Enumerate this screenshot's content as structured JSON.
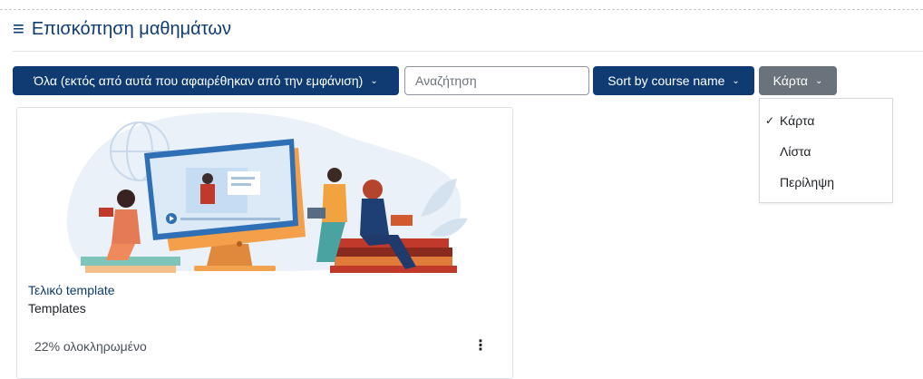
{
  "block": {
    "title": "Επισκόπηση μαθημάτων",
    "menu_icon": "hamburger-icon"
  },
  "controls": {
    "grouping_label": "Όλα (εκτός από αυτά που αφαιρέθηκαν από την εμφάνιση)",
    "search_placeholder": "Αναζήτηση",
    "search_value": "",
    "sort_label": "Sort by course name",
    "view_label": "Κάρτα"
  },
  "view_menu": {
    "items": [
      {
        "label": "Κάρτα",
        "selected": true
      },
      {
        "label": "Λίστα",
        "selected": false
      },
      {
        "label": "Περίληψη",
        "selected": false
      }
    ]
  },
  "courses": [
    {
      "name": "Τελικό template",
      "category": "Templates",
      "progress_text": "22% ολοκληρωμένο",
      "progress_percent": 22
    }
  ],
  "colors": {
    "primary": "#0f3b72",
    "secondary": "#6a737b"
  }
}
